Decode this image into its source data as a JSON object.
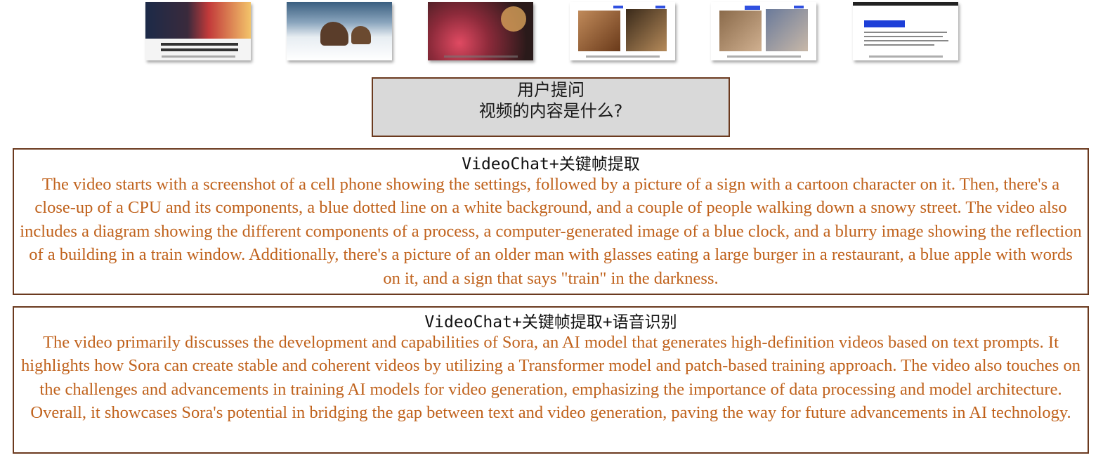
{
  "question": {
    "title": "用户提问",
    "text": "视频的内容是什么?"
  },
  "answers": [
    {
      "title": "VideoChat+关键帧提取",
      "body": "The video starts with a screenshot of a cell phone showing the settings, followed by a picture of a sign with a cartoon character on it. Then, there's a close-up of a CPU and its components, a blue dotted line on a white background, and a couple of people walking down a snowy street. The video also includes a diagram showing the different components of a process, a computer-generated image of a blue clock, and a blurry image showing the reflection of a building in a train window. Additionally, there's a picture of an older man with glasses eating a large burger in a restaurant, a blue apple with words on it, and a sign that says \"train\" in the darkness."
    },
    {
      "title": "VideoChat+关键帧提取+语音识别",
      "body": "The video primarily discusses the development and capabilities of Sora, an AI model that generates high-definition videos based on text prompts. It highlights how Sora can create stable and coherent videos by utilizing a Transformer model and patch-based training approach. The video also touches on the challenges and advancements in training AI models for video generation, emphasizing the importance of data processing and model architecture. Overall, it showcases Sora's potential in bridging the gap between text and video generation, paving the way for future advancements in AI technology."
    }
  ],
  "colors": {
    "border": "#6b3a1f",
    "answer_text": "#c0621c",
    "question_bg": "#d9d9d9"
  }
}
